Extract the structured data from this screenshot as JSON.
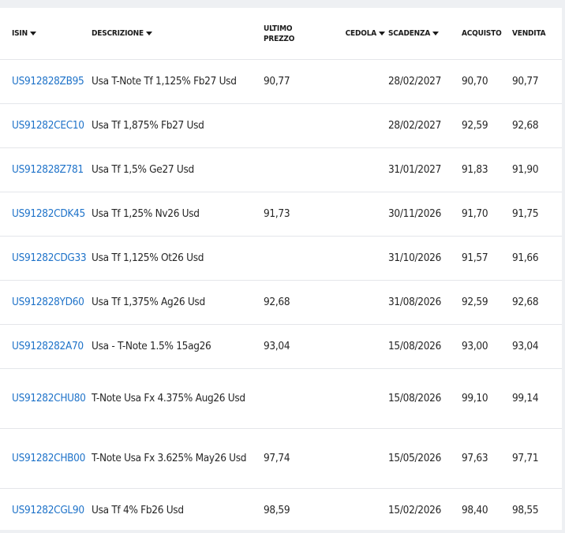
{
  "headers": {
    "isin": "ISIN",
    "descrizione": "DESCRIZIONE",
    "ultimo_prezzo": "ULTIMO PREZZO",
    "cedola": "CEDOLA",
    "scadenza": "SCADENZA",
    "acquisto": "ACQUISTO",
    "vendita": "VENDITA"
  },
  "rows": [
    {
      "isin": "US912828ZB95",
      "descrizione": "Usa T-Note Tf 1,125% Fb27 Usd",
      "ultimo_prezzo": "90,77",
      "cedola": "",
      "scadenza": "28/02/2027",
      "acquisto": "90,70",
      "vendita": "90,77"
    },
    {
      "isin": "US91282CEC10",
      "descrizione": "Usa Tf 1,875% Fb27 Usd",
      "ultimo_prezzo": "",
      "cedola": "",
      "scadenza": "28/02/2027",
      "acquisto": "92,59",
      "vendita": "92,68"
    },
    {
      "isin": "US912828Z781",
      "descrizione": "Usa Tf 1,5% Ge27 Usd",
      "ultimo_prezzo": "",
      "cedola": "",
      "scadenza": "31/01/2027",
      "acquisto": "91,83",
      "vendita": "91,90"
    },
    {
      "isin": "US91282CDK45",
      "descrizione": "Usa Tf 1,25% Nv26 Usd",
      "ultimo_prezzo": "91,73",
      "cedola": "",
      "scadenza": "30/11/2026",
      "acquisto": "91,70",
      "vendita": "91,75"
    },
    {
      "isin": "US91282CDG33",
      "descrizione": "Usa Tf 1,125% Ot26 Usd",
      "ultimo_prezzo": "",
      "cedola": "",
      "scadenza": "31/10/2026",
      "acquisto": "91,57",
      "vendita": "91,66"
    },
    {
      "isin": "US912828YD60",
      "descrizione": "Usa Tf 1,375% Ag26 Usd",
      "ultimo_prezzo": "92,68",
      "cedola": "",
      "scadenza": "31/08/2026",
      "acquisto": "92,59",
      "vendita": "92,68"
    },
    {
      "isin": "US9128282A70",
      "descrizione": "Usa - T-Note 1.5% 15ag26",
      "ultimo_prezzo": "93,04",
      "cedola": "",
      "scadenza": "15/08/2026",
      "acquisto": "93,00",
      "vendita": "93,04"
    },
    {
      "isin": "US91282CHU80",
      "descrizione": "T-Note Usa Fx 4.375% Aug26 Usd",
      "ultimo_prezzo": "",
      "cedola": "",
      "scadenza": "15/08/2026",
      "acquisto": "99,10",
      "vendita": "99,14"
    },
    {
      "isin": "US91282CHB00",
      "descrizione": "T-Note Usa Fx 3.625% May26 Usd",
      "ultimo_prezzo": "97,74",
      "cedola": "",
      "scadenza": "15/05/2026",
      "acquisto": "97,63",
      "vendita": "97,71"
    },
    {
      "isin": "US91282CGL90",
      "descrizione": "Usa Tf 4% Fb26 Usd",
      "ultimo_prezzo": "98,59",
      "cedola": "",
      "scadenza": "15/02/2026",
      "acquisto": "98,40",
      "vendita": "98,55"
    }
  ],
  "colors": {
    "link": "#1f73c9",
    "border": "#e4e6ea",
    "frame": "#eef0f3"
  }
}
